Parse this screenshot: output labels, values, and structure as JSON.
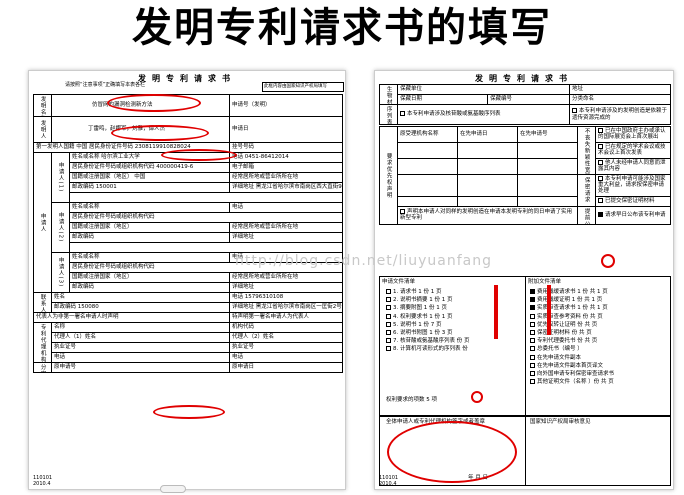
{
  "heading": "发明专利请求书的填写",
  "left": {
    "page_title": "发明专利请求书",
    "note": "请按照“注意事项”正确填写本表各栏",
    "office_box": "此框内容由国家知识产权局填写",
    "rows": {
      "invention_name_label": "发明名称",
      "invention_name": "仿冒网的漏洞检测新方法",
      "inventor_label": "发明人",
      "inventors": "丁雷鸣，赵娜军，刘雅，谭人杰",
      "apply_date": "申请日",
      "divisional": "分案提交日",
      "first_inventor": "第一发明人国籍 中国 居民身份证件号码 2308119910828024",
      "applicant_label": "申请人",
      "name_or_title": "姓名或名称 哈尔滨工业大学",
      "phone": "电话 0451-86412014",
      "code": "居民身份证件号码或组织机构代码 400000419-6",
      "email": "电子邮箱",
      "country": "国籍或注册国家（地区） 中国",
      "province": "经常居所地或营业所所在地",
      "postcode": "邮政编码 150001",
      "address": "详细地址 黑龙江省哈尔滨市南岗区西大直街92号",
      "contact_label": "联系人",
      "contact_phone": "电话 15796310108",
      "contact_email": "邮箱 15958991108@163.com",
      "contact_post": "邮政编码 150080",
      "contact_addr": "详细地址 黑龙江省哈尔滨市南岗区一匡街2号",
      "rep": "代表人为非第一署名申请人时声明",
      "rep2": "特声明第一署名申请人为代表人",
      "agency_label": "专利代理机构",
      "agency_name": "名称",
      "agency_code": "机构代码",
      "agent1": "代理人（1）姓名",
      "agent2": "代理人（2）姓名",
      "cert": "执业证号",
      "tel": "电话",
      "divisional_req": "分案申请",
      "orig_no": "原申请号",
      "orig_date": "原申请日",
      "bio": "生物材料样品"
    },
    "footer_a": "110101",
    "footer_b": "2010.4",
    "right_labels": {
      "a": "申请号（发明）",
      "b": "分案提交日",
      "c": "申请日",
      "d": "费减审批",
      "e": "挂号号码"
    }
  },
  "right": {
    "page_title": "发明专利请求书",
    "rows": {
      "bio_material": "生物材料样品",
      "keep_unit": "保藏单位",
      "keep_addr": "地址",
      "keep_date": "保藏日期",
      "keep_date_val": "年  月  日",
      "keep_no": "保藏编号",
      "class_name": "分类命名",
      "seq_table": "序列表",
      "seq_text": "本专利申请涉及核苷酸或氨基酸序列表",
      "genetic": "遗传资源",
      "genetic_text": "本专利申请涉及的发明创造是依赖于遗传资源完成的",
      "priority": "要求优先权声明",
      "orig_office": "原受理机构名称",
      "first_date": "在先申请日",
      "first_no": "在先申请号",
      "exempt": "不丧失新颖性宽限期声明",
      "exempt1": "已在中国政府主办或承认的国际展览会上首次展出",
      "exempt2": "已在规定的学术会议或技术会议上首次发表",
      "exempt3": "他人未经申请人同意而泄露其内容",
      "early_pub": "保密请求",
      "pub1": "本专利申请可能涉及国家重大利益，请求按保密申请处理",
      "pub2": "已提交保密证明材料",
      "simultaneous": "声明本申请人对同样的发明创造在申请本发明专利的同日申请了实用新型专利",
      "early_publish": "提前公布",
      "early_publish_text": "请求早日公布该专利申请",
      "docs_header": "申请文件清单",
      "attach_header": "附加文件清单",
      "docs": [
        "1. 请求书  1 份 1 页",
        "2. 说明书摘要  1 份 1 页",
        "3. 摘要附图  1 份 1 页",
        "4. 权利要求书  1 份 1 页",
        "5. 说明书  1 份 7 页",
        "6. 说明书附图  1 份 3 页",
        "7. 核苷酸或氨基酸序列表  份 页",
        "8. 计算机可读形式的序列表  份"
      ],
      "attach": [
        "费用减缓请求书  1 份 共 1 页",
        "费用减缓证明  1 份 共 1 页",
        "实质审查请求书  1 份 共 1 页",
        "实质审查参考资料  份 共 页",
        "优先权转让证明  份 共 页",
        "保密证明材料  份 共 页",
        "专利代理委托书  份 共 页",
        "总委托书（编号  ）",
        "在先申请文件副本",
        "在先申请文件副本首页译文",
        "向外国申请专利保密审查请求书",
        "其他证明文件（名称  ）份 共 页"
      ],
      "per_fig": "权利要求的项数",
      "per_fig_val": "5",
      "per_fig_tail": "项",
      "sign": "全体申请人或专利代理机构签字或者盖章",
      "sign_date": "年  月  日",
      "office_check": "国家知识产权局审核意见"
    },
    "footer_a": "110101",
    "footer_b": "2010.4"
  },
  "watermark": "http://blog.csdn.net/liuyuanfang",
  "colors": {
    "annotation": "#e00000"
  }
}
